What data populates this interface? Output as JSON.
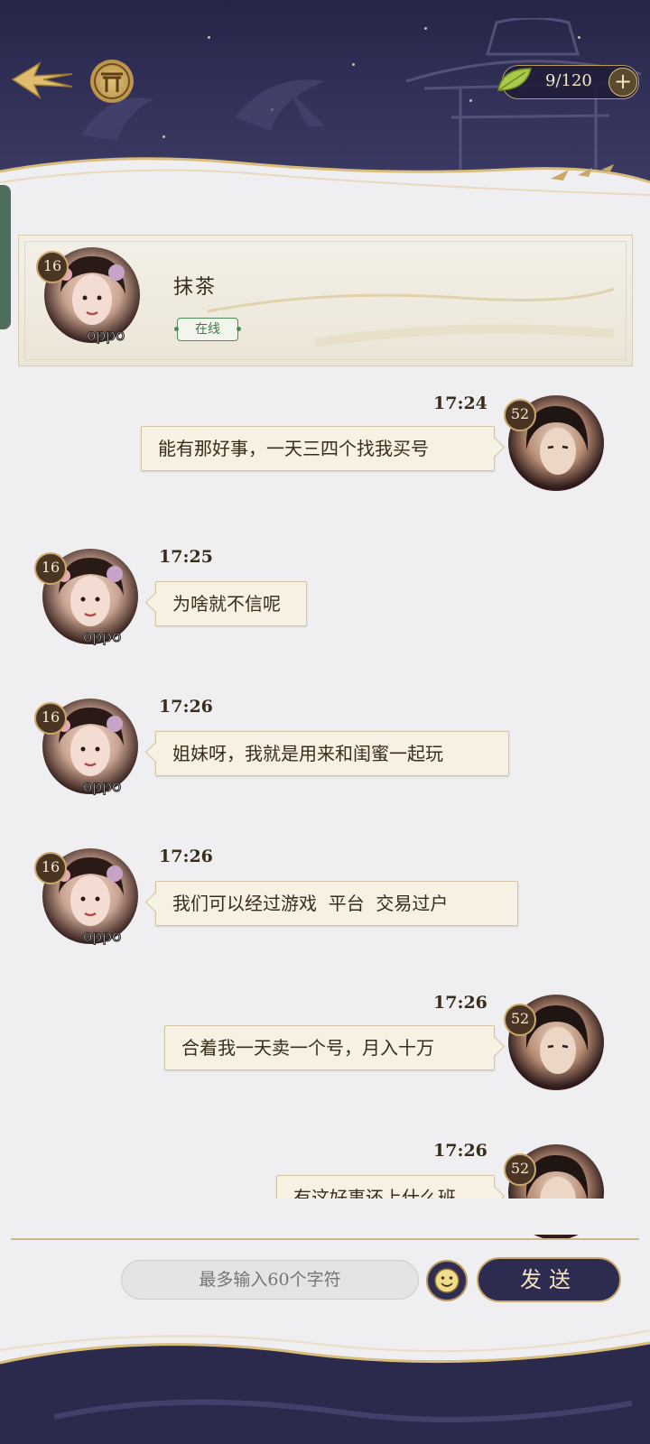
{
  "header": {
    "stamina": "9/120",
    "plus_label": "+"
  },
  "contact": {
    "name": "抹茶",
    "status": "在线",
    "level": "16",
    "avatar_badge": "oppo"
  },
  "me": {
    "level": "52"
  },
  "messages": [
    {
      "side": "right",
      "time": "17:24",
      "text": "能有那好事，一天三四个找我买号"
    },
    {
      "side": "left",
      "time": "17:25",
      "text": "为啥就不信呢"
    },
    {
      "side": "left",
      "time": "17:26",
      "text": "姐妹呀，我就是用来和闺蜜一起玩"
    },
    {
      "side": "left",
      "time": "17:26",
      "text": "我们可以经过游戏  平台  交易过户"
    },
    {
      "side": "right",
      "time": "17:26",
      "text": "合着我一天卖一个号，月入十万"
    },
    {
      "side": "right",
      "time": "17:26",
      "text": "有这好事还上什么班"
    }
  ],
  "input": {
    "placeholder": "最多输入60个字符"
  },
  "send_label": "发送",
  "colors": {
    "banner": "#2b2a4c",
    "bubble": "#f6f1e3",
    "gold": "#c9a869",
    "online": "#3d7a46"
  },
  "icons": [
    "back-arrow-icon",
    "gate-icon",
    "leaf-icon",
    "plus-icon",
    "emoji-icon"
  ]
}
